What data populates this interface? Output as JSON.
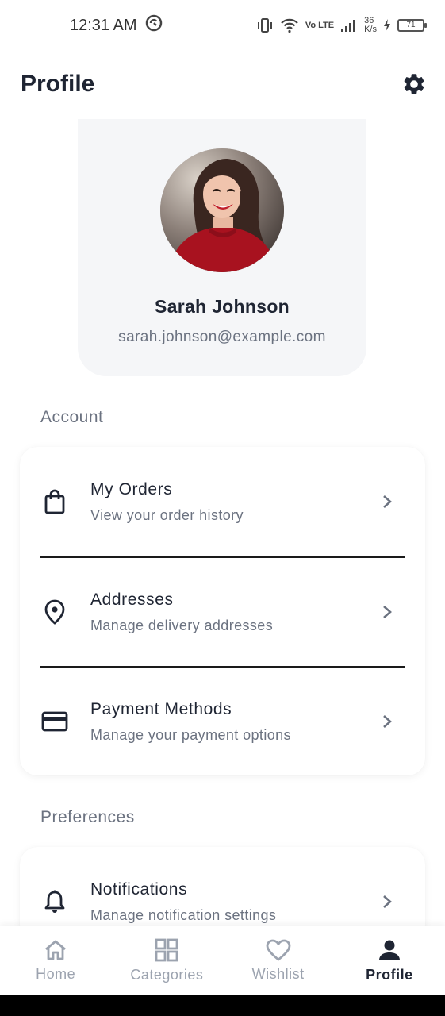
{
  "status_bar": {
    "time": "12:31 AM",
    "network_type": "Vo LTE",
    "speed_value": "36",
    "speed_unit": "K/s",
    "battery_level": "71",
    "icons": [
      "vibrate-icon",
      "wifi-icon",
      "signal-icon",
      "charging-icon",
      "battery-icon",
      "sync-icon"
    ]
  },
  "header": {
    "title": "Profile",
    "settings_icon": "gear-icon"
  },
  "profile": {
    "name": "Sarah Johnson",
    "email": "sarah.johnson@example.com"
  },
  "sections": [
    {
      "title": "Account",
      "items": [
        {
          "title": "My Orders",
          "subtitle": "View your order history",
          "icon": "shopping-bag-icon"
        },
        {
          "title": "Addresses",
          "subtitle": "Manage delivery addresses",
          "icon": "location-pin-icon"
        },
        {
          "title": "Payment Methods",
          "subtitle": "Manage your payment options",
          "icon": "credit-card-icon"
        }
      ]
    },
    {
      "title": "Preferences",
      "items": [
        {
          "title": "Notifications",
          "subtitle": "Manage notification settings",
          "icon": "bell-icon"
        }
      ]
    }
  ],
  "bottom_nav": {
    "items": [
      {
        "label": "Home",
        "icon": "home-icon",
        "active": false
      },
      {
        "label": "Categories",
        "icon": "grid-icon",
        "active": false
      },
      {
        "label": "Wishlist",
        "icon": "heart-icon",
        "active": false
      },
      {
        "label": "Profile",
        "icon": "person-icon",
        "active": true
      }
    ]
  },
  "colors": {
    "primary_text": "#1f2533",
    "secondary_text": "#6b7280",
    "card_background": "#f5f6f8",
    "nav_inactive": "#9ca3af"
  }
}
